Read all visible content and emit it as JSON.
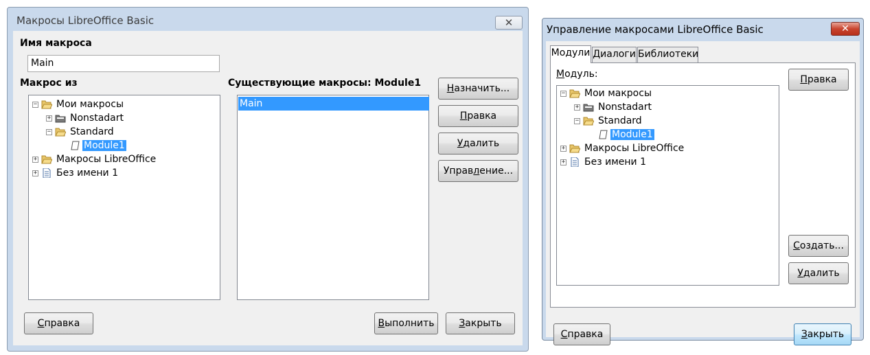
{
  "dialog1": {
    "title": "Макросы LibreOffice Basic",
    "close_glyph": "✕",
    "macro_name_label": "Имя макроса",
    "macro_name_value": "Main",
    "macro_from_label": "Макрос из",
    "existing_macros_label": "Существующие макросы: Module1",
    "tree": {
      "my_macros": "Мои макросы",
      "nonstadart": "Nonstadart",
      "standard": "Standard",
      "module1": "Module1",
      "libreoffice_macros": "Макросы LibreOffice",
      "untitled": "Без имени 1"
    },
    "macro_list": [
      "Main"
    ],
    "buttons": {
      "assign": {
        "pre": "",
        "u": "Н",
        "post": "азначить..."
      },
      "edit": {
        "pre": "",
        "u": "П",
        "post": "равка"
      },
      "delete": {
        "pre": "",
        "u": "У",
        "post": "далить"
      },
      "organize": {
        "pre": "Управ",
        "u": "л",
        "post": "ение..."
      },
      "help": {
        "pre": "",
        "u": "С",
        "post": "правка"
      },
      "run": {
        "pre": "",
        "u": "В",
        "post": "ыполнить"
      },
      "close": {
        "pre": "",
        "u": "З",
        "post": "акрыть"
      }
    }
  },
  "dialog2": {
    "title": "Управление макросами LibreOffice Basic",
    "close_glyph": "✕",
    "tabs": [
      "Модули",
      "Диалоги",
      "Библиотеки"
    ],
    "module_label_u": "М",
    "module_label_rest": "одуль:",
    "tree": {
      "my_macros": "Мои макросы",
      "nonstadart": "Nonstadart",
      "standard": "Standard",
      "module1": "Module1",
      "libreoffice_macros": "Макросы LibreOffice",
      "untitled": "Без имени 1"
    },
    "buttons": {
      "edit": {
        "pre": "",
        "u": "П",
        "post": "равка"
      },
      "new": {
        "pre": "",
        "u": "С",
        "post": "оздать..."
      },
      "delete": {
        "pre": "",
        "u": "У",
        "post": "далить"
      },
      "help": {
        "pre": "",
        "u": "С",
        "post": "правка"
      },
      "close": {
        "pre": "",
        "u": "З",
        "post": "акрыть"
      }
    }
  }
}
